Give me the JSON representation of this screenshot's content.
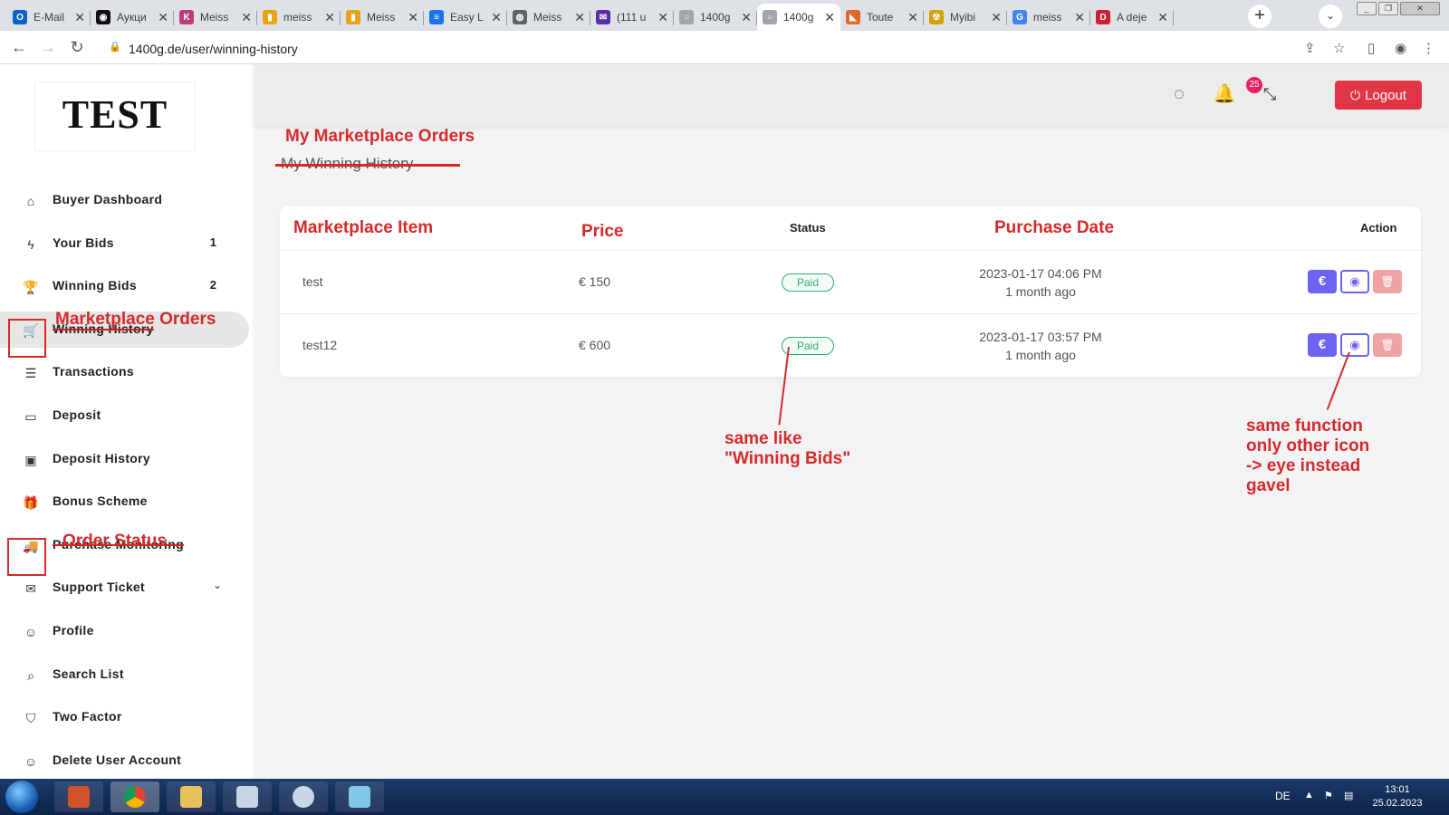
{
  "browser": {
    "tabs": [
      {
        "title": "E-Mail",
        "fav_color": "#0a64c8",
        "fav_glyph": "O"
      },
      {
        "title": "Аукци",
        "fav_color": "#111111",
        "fav_glyph": "◉"
      },
      {
        "title": "Meiss",
        "fav_color": "#c03b7a",
        "fav_glyph": "K"
      },
      {
        "title": "meiss",
        "fav_color": "#e8a317",
        "fav_glyph": "▮"
      },
      {
        "title": "Meiss",
        "fav_color": "#e8a317",
        "fav_glyph": "▮"
      },
      {
        "title": "Easy L",
        "fav_color": "#1a73e8",
        "fav_glyph": "≡"
      },
      {
        "title": "Meiss",
        "fav_color": "#5f6368",
        "fav_glyph": "◍"
      },
      {
        "title": "(111 u",
        "fav_color": "#5b2aa8",
        "fav_glyph": "✉"
      },
      {
        "title": "1400g",
        "fav_color": "#a0a6b0",
        "fav_glyph": "○"
      },
      {
        "title": "1400g",
        "fav_color": "#a0a6b0",
        "fav_glyph": "○"
      },
      {
        "title": "Toute",
        "fav_color": "#e0672a",
        "fav_glyph": "◣"
      },
      {
        "title": "Myibi",
        "fav_color": "#d8a000",
        "fav_glyph": "☢"
      },
      {
        "title": "meiss",
        "fav_color": "#4285f4",
        "fav_glyph": "G"
      },
      {
        "title": "A deje",
        "fav_color": "#cc1f2f",
        "fav_glyph": "D"
      }
    ],
    "active_tab_index": 9,
    "url": "1400g.de/user/winning-history"
  },
  "logo_text": "TEST",
  "sidebar": {
    "items": [
      {
        "label": "Buyer Dashboard",
        "icon": "home-icon",
        "glyph": "⌂",
        "count": ""
      },
      {
        "label": "Your Bids",
        "icon": "bolt-icon",
        "glyph": "ϟ",
        "count": "1"
      },
      {
        "label": "Winning Bids",
        "icon": "trophy-icon",
        "glyph": "🏆",
        "count": "2"
      },
      {
        "label": "Winning History",
        "icon": "cart-icon",
        "glyph": "🛒",
        "count": ""
      },
      {
        "label": "Transactions",
        "icon": "list-icon",
        "glyph": "☰",
        "count": ""
      },
      {
        "label": "Deposit",
        "icon": "credit-card-icon",
        "glyph": "▭",
        "count": ""
      },
      {
        "label": "Deposit History",
        "icon": "wallet-icon",
        "glyph": "▣",
        "count": ""
      },
      {
        "label": "Bonus Scheme",
        "icon": "gift-icon",
        "glyph": "🎁",
        "count": ""
      },
      {
        "label": "Purchase Monitoring",
        "icon": "truck-icon",
        "glyph": "🚚",
        "count": ""
      },
      {
        "label": "Support Ticket",
        "icon": "mail-icon",
        "glyph": "✉",
        "count": ""
      },
      {
        "label": "Profile",
        "icon": "user-icon",
        "glyph": "☺",
        "count": ""
      },
      {
        "label": "Search List",
        "icon": "search-icon",
        "glyph": "⌕",
        "count": ""
      },
      {
        "label": "Two Factor",
        "icon": "shield-icon",
        "glyph": "⛉",
        "count": ""
      },
      {
        "label": "Delete User Account",
        "icon": "user-x-icon",
        "glyph": "☺",
        "count": ""
      }
    ]
  },
  "header": {
    "notification_count": "25",
    "logout_label": "Logout"
  },
  "page": {
    "heading_new": "My Marketplace Orders",
    "heading_old": "My Winning History"
  },
  "table": {
    "headers": {
      "item": "Marketplace Item",
      "price": "Price",
      "status": "Status",
      "date": "Purchase Date",
      "action": "Action"
    },
    "rows": [
      {
        "item": "test",
        "price": "€ 150",
        "status": "Paid",
        "date": "2023-01-17 04:06 PM",
        "ago": "1 month ago"
      },
      {
        "item": "test12",
        "price": "€ 600",
        "status": "Paid",
        "date": "2023-01-17 03:57 PM",
        "ago": "1 month ago"
      }
    ]
  },
  "annotations": {
    "marketplace_orders": "Marketplace Orders",
    "order_status": "Order Status",
    "status_note": [
      "same like",
      "\"Winning Bids\""
    ],
    "eye_note": [
      "same function",
      "only other icon",
      "-> eye instead",
      "gavel"
    ]
  },
  "taskbar": {
    "lang": "DE",
    "time": "13:01",
    "date": "25.02.2023"
  },
  "colors": {
    "accent_red": "#d42a2a",
    "logout_red": "#e03545",
    "action_purple": "#6c63f0",
    "paid_green": "#2eae6a"
  }
}
